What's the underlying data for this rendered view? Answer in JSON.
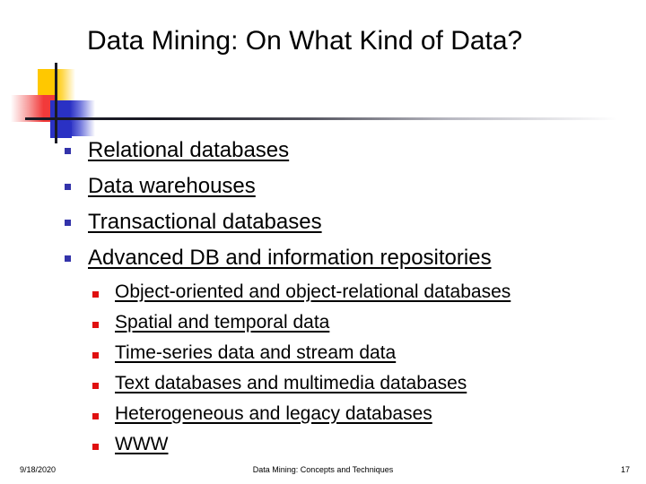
{
  "slide": {
    "title": "Data Mining: On What Kind of Data?",
    "colors": {
      "bullet_level1": "#3333AA",
      "bullet_level2": "#E01010",
      "logo_yellow": "#FFC800",
      "logo_red": "#F23A3A",
      "logo_blue": "#2A31C4",
      "rule": "#1A1A24",
      "text": "#000000",
      "background": "#FFFFFF"
    },
    "bullets_level1": [
      {
        "label": "Relational databases"
      },
      {
        "label": "Data warehouses"
      },
      {
        "label": "Transactional databases"
      },
      {
        "label": "Advanced DB and information repositories"
      }
    ],
    "bullets_level2": [
      {
        "label": "Object-oriented and object-relational databases"
      },
      {
        "label": "Spatial and temporal data"
      },
      {
        "label": "Time-series data and stream data"
      },
      {
        "label": "Text databases and multimedia databases"
      },
      {
        "label": "Heterogeneous and legacy databases"
      },
      {
        "label": "WWW"
      }
    ],
    "footer": {
      "date": "9/18/2020",
      "center": "Data Mining: Concepts and Techniques",
      "page": "17"
    }
  }
}
